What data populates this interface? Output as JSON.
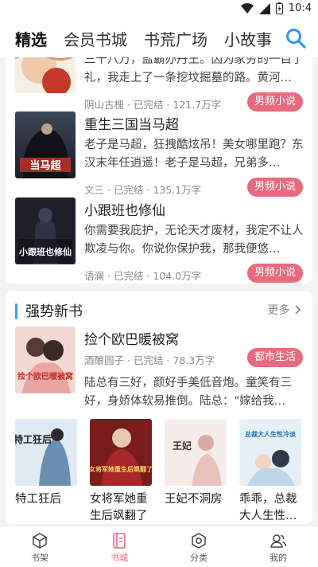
{
  "status_bar": {
    "time": "10:4"
  },
  "top_tabs": [
    {
      "label": "精选",
      "active": true
    },
    {
      "label": "会员书城",
      "active": false
    },
    {
      "label": "书荒广场",
      "active": false
    },
    {
      "label": "小故事",
      "active": false
    }
  ],
  "ranking_list": [
    {
      "title": "",
      "desc": "三十八万，盐霸办丹王。因为家穷的一百了礼，我走上了一条挖坟掘墓的路。黄河…",
      "author": "阴山古槐",
      "status": "已完结",
      "words": "121.7万字",
      "tag": "男频小说"
    },
    {
      "title": "重生三国当马超",
      "desc": "老子是马超，狂拽酷炫吊！美女哪里跑？东汉末年任逍遥！老子是马超，兄弟多…",
      "author": "文三",
      "status": "已完结",
      "words": "135.1万字",
      "tag": "男频小说",
      "cover_text": "当马超"
    },
    {
      "title": "小跟班也修仙",
      "desc": "你需要我庇护，无论天才废材，我定不让人欺凌与你。你说你保护我，那我便悠…",
      "author": "语澜",
      "status": "已完结",
      "words": "104.0万字",
      "tag": "男频小说",
      "cover_text": "小跟班也修仙"
    }
  ],
  "new_books": {
    "title": "强势新书",
    "more_label": "更多",
    "featured": {
      "title": "捡个欧巴暖被窝",
      "author": "酒酿圆子",
      "status": "已完结",
      "words": "78.3万字",
      "tag": "都市生活",
      "desc": "陆总有三好，颜好手美低音炮。童笑有三好，身娇体软易推倒。陆总：\"嫁给我…",
      "cover_text": "捡个欧巴暖被窝"
    },
    "grid": [
      {
        "title": "特工狂后",
        "cover_text": "特工狂后"
      },
      {
        "title": "女将军她重生后飒翻了",
        "cover_text": "女将军她重生后飒翻了"
      },
      {
        "title": "王妃不洞房",
        "cover_text": "王妃"
      },
      {
        "title": "乖乖，总裁大人生性…",
        "cover_text": "总裁大人生性冷淡"
      }
    ]
  },
  "bottom_nav": [
    {
      "label": "书架",
      "icon": "bookshelf-icon",
      "active": false
    },
    {
      "label": "书城",
      "icon": "bookstore-icon",
      "active": true
    },
    {
      "label": "分类",
      "icon": "category-icon",
      "active": false
    },
    {
      "label": "我的",
      "icon": "profile-icon",
      "active": false
    }
  ],
  "colors": {
    "accent_pink": "#e96a7e",
    "accent_blue": "#3aa0f0"
  }
}
